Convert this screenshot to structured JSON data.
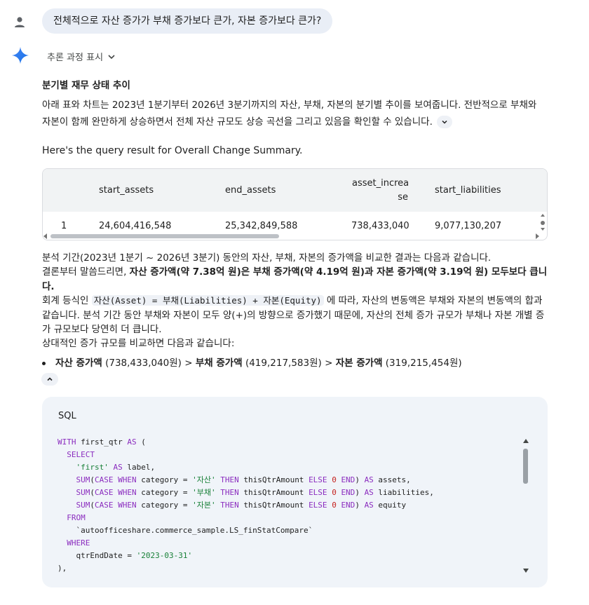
{
  "user_message": "전체적으로 자산 증가가 부채 증가보다 큰가, 자본 증가보다 큰가?",
  "reasoning_toggle": "추론 과정 표시",
  "section": {
    "title": "분기별 재무 상태 추이",
    "paragraph": "아래 표와 차트는 2023년 1분기부터 2026년 3분기까지의 자산, 부채, 자본의 분기별 추이를 보여줍니다. 전반적으로 부채와 자본이 함께 완만하게 상승하면서 전체 자산 규모도 상승 곡선을 그리고 있음을 확인할 수 있습니다."
  },
  "query_result_line": "Here's the query result for Overall Change Summary.",
  "table": {
    "headers": {
      "start_assets": "start_assets",
      "end_assets": "end_assets",
      "asset_increase_1": "asset_increa",
      "asset_increase_2": "se",
      "start_liabilities": "start_liabilities"
    },
    "row": {
      "index": "1",
      "start_assets": "24,604,416,548",
      "end_assets": "25,342,849,588",
      "asset_increase": "738,433,040",
      "start_liabilities": "9,077,130,207"
    }
  },
  "explain": {
    "line1": "분석 기간(2023년 1분기 ~ 2026년 3분기) 동안의 자산, 부채, 자본의 증가액을 비교한 결과는 다음과 같습니다.",
    "line2_prefix": "결론부터 말씀드리면, ",
    "line2_bold1": "자산 증가액(약 7.38억 원)은 부채 증가액(약 4.19억 원)과 자본 증가액(약 3.19억 원) 모두보다 큽니다.",
    "line3_prefix": "회계 등식인 ",
    "line3_code": "자산(Asset) = 부채(Liabilities) + 자본(Equity)",
    "line3_suffix": " 에 따라, 자산의 변동액은 부채와 자본의 변동액의 합과 같습니다. 분석 기간 동안 부채와 자본이 모두 양(+)의 방향으로 증가했기 때문에, 자산의 전체 증가 규모가 부채나 자본 개별 증가 규모보다 당연히 더 큽니다.",
    "line4": "상대적인 증가 규모를 비교하면 다음과 같습니다:"
  },
  "bullet": {
    "asset_label": "자산 증가액",
    "asset_value": " (738,433,040원) > ",
    "liab_label": "부채 증가액",
    "liab_value": " (419,217,583원) > ",
    "equity_label": "자본 증가액",
    "equity_value": " (319,215,454원)"
  },
  "sql": {
    "label": "SQL"
  },
  "icons": {
    "user": "person-icon",
    "gemini": "sparkle-icon"
  },
  "colors": {
    "bubble": "#e9eef6",
    "gemini_blue": "#4285f4",
    "keyword": "#8b2dbf",
    "string": "#188038",
    "number": "#c5221f"
  }
}
